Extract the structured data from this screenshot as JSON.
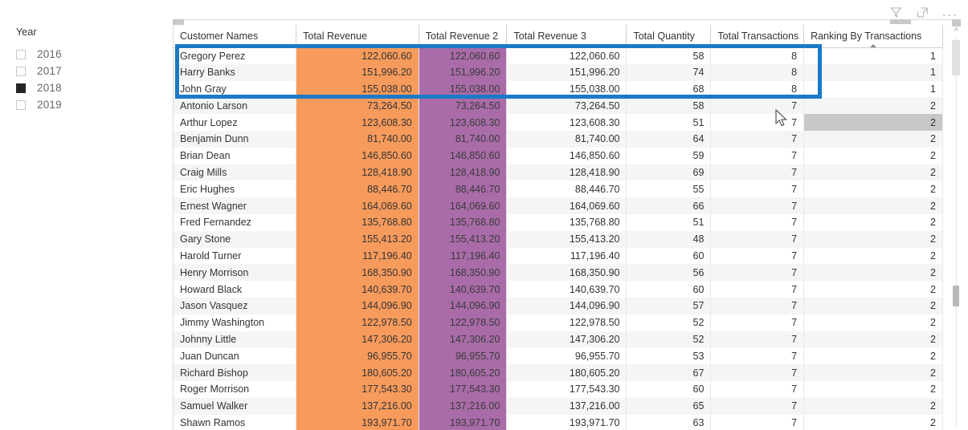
{
  "visual_header": {
    "filter_icon": "filter-icon",
    "focus_icon": "focus-mode-icon",
    "more_icon": "more-options-icon",
    "more_label": "..."
  },
  "slicer": {
    "title": "Year",
    "items": [
      {
        "label": "2016",
        "checked": false
      },
      {
        "label": "2017",
        "checked": false
      },
      {
        "label": "2018",
        "checked": true
      },
      {
        "label": "2019",
        "checked": false
      }
    ]
  },
  "table": {
    "columns": [
      "Customer Names",
      "Total Revenue",
      "Total Revenue 2",
      "Total Revenue 3",
      "Total Quantity",
      "Total Transactions",
      "Ranking By Transactions"
    ],
    "sorted_column": "Ranking By Transactions",
    "rows": [
      {
        "name": "Gregory Perez",
        "rev": "122,060.60",
        "rev2": "122,060.60",
        "rev3": "122,060.60",
        "qty": "58",
        "tx": "8",
        "rank": "1"
      },
      {
        "name": "Harry Banks",
        "rev": "151,996.20",
        "rev2": "151,996.20",
        "rev3": "151,996.20",
        "qty": "74",
        "tx": "8",
        "rank": "1"
      },
      {
        "name": "John Gray",
        "rev": "155,038.00",
        "rev2": "155,038.00",
        "rev3": "155,038.00",
        "qty": "68",
        "tx": "8",
        "rank": "1"
      },
      {
        "name": "Antonio Larson",
        "rev": "73,264.50",
        "rev2": "73,264.50",
        "rev3": "73,264.50",
        "qty": "58",
        "tx": "7",
        "rank": "2"
      },
      {
        "name": "Arthur Lopez",
        "rev": "123,608.30",
        "rev2": "123,608.30",
        "rev3": "123,608.30",
        "qty": "51",
        "tx": "7",
        "rank": "2"
      },
      {
        "name": "Benjamin Dunn",
        "rev": "81,740.00",
        "rev2": "81,740.00",
        "rev3": "81,740.00",
        "qty": "64",
        "tx": "7",
        "rank": "2"
      },
      {
        "name": "Brian Dean",
        "rev": "146,850.60",
        "rev2": "146,850.60",
        "rev3": "146,850.60",
        "qty": "59",
        "tx": "7",
        "rank": "2"
      },
      {
        "name": "Craig Mills",
        "rev": "128,418.90",
        "rev2": "128,418.90",
        "rev3": "128,418.90",
        "qty": "69",
        "tx": "7",
        "rank": "2"
      },
      {
        "name": "Eric Hughes",
        "rev": "88,446.70",
        "rev2": "88,446.70",
        "rev3": "88,446.70",
        "qty": "55",
        "tx": "7",
        "rank": "2"
      },
      {
        "name": "Ernest Wagner",
        "rev": "164,069.60",
        "rev2": "164,069.60",
        "rev3": "164,069.60",
        "qty": "66",
        "tx": "7",
        "rank": "2"
      },
      {
        "name": "Fred Fernandez",
        "rev": "135,768.80",
        "rev2": "135,768.80",
        "rev3": "135,768.80",
        "qty": "51",
        "tx": "7",
        "rank": "2"
      },
      {
        "name": "Gary Stone",
        "rev": "155,413.20",
        "rev2": "155,413.20",
        "rev3": "155,413.20",
        "qty": "48",
        "tx": "7",
        "rank": "2"
      },
      {
        "name": "Harold Turner",
        "rev": "117,196.40",
        "rev2": "117,196.40",
        "rev3": "117,196.40",
        "qty": "60",
        "tx": "7",
        "rank": "2"
      },
      {
        "name": "Henry Morrison",
        "rev": "168,350.90",
        "rev2": "168,350.90",
        "rev3": "168,350.90",
        "qty": "56",
        "tx": "7",
        "rank": "2"
      },
      {
        "name": "Howard Black",
        "rev": "140,639.70",
        "rev2": "140,639.70",
        "rev3": "140,639.70",
        "qty": "60",
        "tx": "7",
        "rank": "2"
      },
      {
        "name": "Jason Vasquez",
        "rev": "144,096.90",
        "rev2": "144,096.90",
        "rev3": "144,096.90",
        "qty": "57",
        "tx": "7",
        "rank": "2"
      },
      {
        "name": "Jimmy Washington",
        "rev": "122,978.50",
        "rev2": "122,978.50",
        "rev3": "122,978.50",
        "qty": "52",
        "tx": "7",
        "rank": "2"
      },
      {
        "name": "Johnny Little",
        "rev": "147,306.20",
        "rev2": "147,306.20",
        "rev3": "147,306.20",
        "qty": "52",
        "tx": "7",
        "rank": "2"
      },
      {
        "name": "Juan Duncan",
        "rev": "96,955.70",
        "rev2": "96,955.70",
        "rev3": "96,955.70",
        "qty": "53",
        "tx": "7",
        "rank": "2"
      },
      {
        "name": "Richard Bishop",
        "rev": "180,605.20",
        "rev2": "180,605.20",
        "rev3": "180,605.20",
        "qty": "67",
        "tx": "7",
        "rank": "2"
      },
      {
        "name": "Roger Morrison",
        "rev": "177,543.30",
        "rev2": "177,543.30",
        "rev3": "177,543.30",
        "qty": "60",
        "tx": "7",
        "rank": "2"
      },
      {
        "name": "Samuel Walker",
        "rev": "137,216.00",
        "rev2": "137,216.00",
        "rev3": "137,216.00",
        "qty": "65",
        "tx": "7",
        "rank": "2"
      },
      {
        "name": "Shawn Ramos",
        "rev": "193,971.70",
        "rev2": "193,971.70",
        "rev3": "193,971.70",
        "qty": "63",
        "tx": "7",
        "rank": "2"
      }
    ],
    "selection_highlight_rows": [
      0,
      1,
      2
    ],
    "hover_row_index": 4,
    "hover_column": "Ranking By Transactions"
  },
  "colors": {
    "data_bar_orange": "#F79B5C",
    "data_bar_purple": "#A96CA8",
    "selection_blue": "#1B7AC8",
    "row_band": "#F5F5F5",
    "hover_grey": "#C8C8C8"
  }
}
